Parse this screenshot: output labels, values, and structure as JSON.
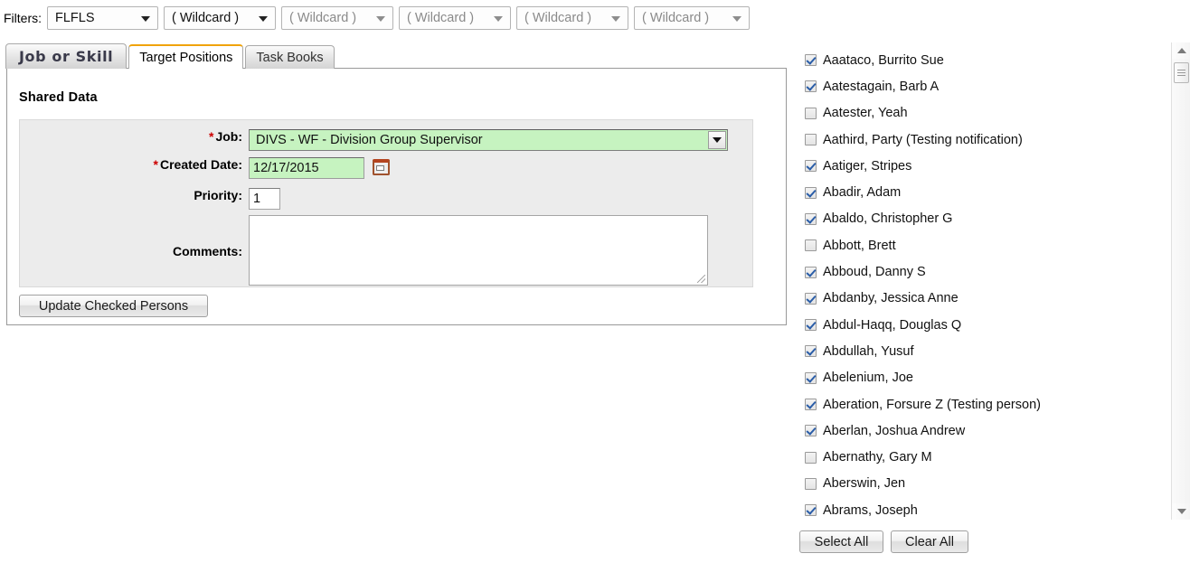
{
  "filters": {
    "label": "Filters:",
    "selects": [
      {
        "name": "filter-primary",
        "value": "FLFLS",
        "dim": false
      },
      {
        "name": "filter-wildcard-1",
        "value": "( Wildcard )",
        "dim": false
      },
      {
        "name": "filter-wildcard-2",
        "value": "( Wildcard )",
        "dim": true
      },
      {
        "name": "filter-wildcard-3",
        "value": "( Wildcard )",
        "dim": true
      },
      {
        "name": "filter-wildcard-4",
        "value": "( Wildcard )",
        "dim": true
      },
      {
        "name": "filter-wildcard-5",
        "value": "( Wildcard )",
        "dim": true
      }
    ]
  },
  "tabs": [
    {
      "label": "Job or Skill",
      "active": false
    },
    {
      "label": "Target Positions",
      "active": true
    },
    {
      "label": "Task Books",
      "active": false
    }
  ],
  "panel": {
    "section_title": "Shared Data",
    "fields": {
      "job": {
        "label": "Job:",
        "required_marker": "*",
        "value": "DIVS - WF - Division Group Supervisor"
      },
      "created_date": {
        "label": "Created Date:",
        "required_marker": "*",
        "value": "12/17/2015",
        "icon": "calendar-icon"
      },
      "priority": {
        "label": "Priority:",
        "value": "1"
      },
      "comments": {
        "label": "Comments:",
        "value": "",
        "placeholder": ""
      }
    },
    "update_button": "Update Checked Persons"
  },
  "person_list": {
    "people": [
      {
        "name": "Aaataco, Burrito Sue",
        "checked": true
      },
      {
        "name": "Aatestagain, Barb A",
        "checked": true
      },
      {
        "name": "Aatester, Yeah",
        "checked": false
      },
      {
        "name": "Aathird, Party (Testing notification)",
        "checked": false
      },
      {
        "name": "Aatiger, Stripes",
        "checked": true
      },
      {
        "name": "Abadir, Adam",
        "checked": true
      },
      {
        "name": "Abaldo, Christopher G",
        "checked": true
      },
      {
        "name": "Abbott, Brett",
        "checked": false
      },
      {
        "name": "Abboud, Danny S",
        "checked": true
      },
      {
        "name": "Abdanby, Jessica Anne",
        "checked": true
      },
      {
        "name": "Abdul-Haqq, Douglas Q",
        "checked": true
      },
      {
        "name": "Abdullah, Yusuf",
        "checked": true
      },
      {
        "name": "Abelenium, Joe",
        "checked": true
      },
      {
        "name": "Aberation, Forsure Z (Testing person)",
        "checked": true
      },
      {
        "name": "Aberlan, Joshua Andrew",
        "checked": true
      },
      {
        "name": "Abernathy, Gary M",
        "checked": false
      },
      {
        "name": "Aberswin, Jen",
        "checked": false
      },
      {
        "name": "Abrams, Joseph",
        "checked": true
      }
    ],
    "select_all_button": "Select All",
    "clear_all_button": "Clear All"
  },
  "colors": {
    "required_marker": "#cc0000",
    "active_tab_accent": "#f0a30a",
    "filled_field_background": "#c6f3c0",
    "panel_background": "#ececec"
  }
}
